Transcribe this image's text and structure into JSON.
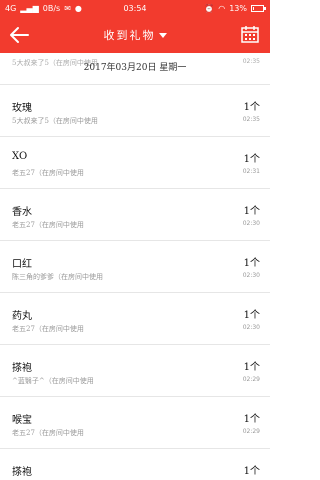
{
  "status_bar": {
    "network": "4G",
    "speed": "0B/s",
    "time": "03:54",
    "battery_label": "13%",
    "battery_level": 0.13
  },
  "header": {
    "title": "收到礼物"
  },
  "date_line": "2017年03月20日 星期一",
  "partial_item": {
    "sub": "5大叔来了5（在房间中使用",
    "time": "02:35"
  },
  "items": [
    {
      "name": "玫瑰",
      "sub": "5大叔来了5（在房间中使用",
      "count": "1个",
      "time": "02:35"
    },
    {
      "name": "XO",
      "sub": "老五27（在房间中使用",
      "count": "1个",
      "time": "02:31"
    },
    {
      "name": "香水",
      "sub": "老五27（在房间中使用",
      "count": "1个",
      "time": "02:30"
    },
    {
      "name": "口红",
      "sub": "陈三角的爹爹（在房间中使用",
      "count": "1个",
      "time": "02:30"
    },
    {
      "name": "药丸",
      "sub": "老五27（在房间中使用",
      "count": "1个",
      "time": "02:30"
    },
    {
      "name": "搽袍",
      "sub": "^蓝翳子^（在房间中使用",
      "count": "1个",
      "time": "02:29"
    },
    {
      "name": "喉宝",
      "sub": "老五27（在房间中使用",
      "count": "1个",
      "time": "02:29"
    },
    {
      "name": "搽袍",
      "sub": "",
      "count": "1个",
      "time": ""
    }
  ]
}
